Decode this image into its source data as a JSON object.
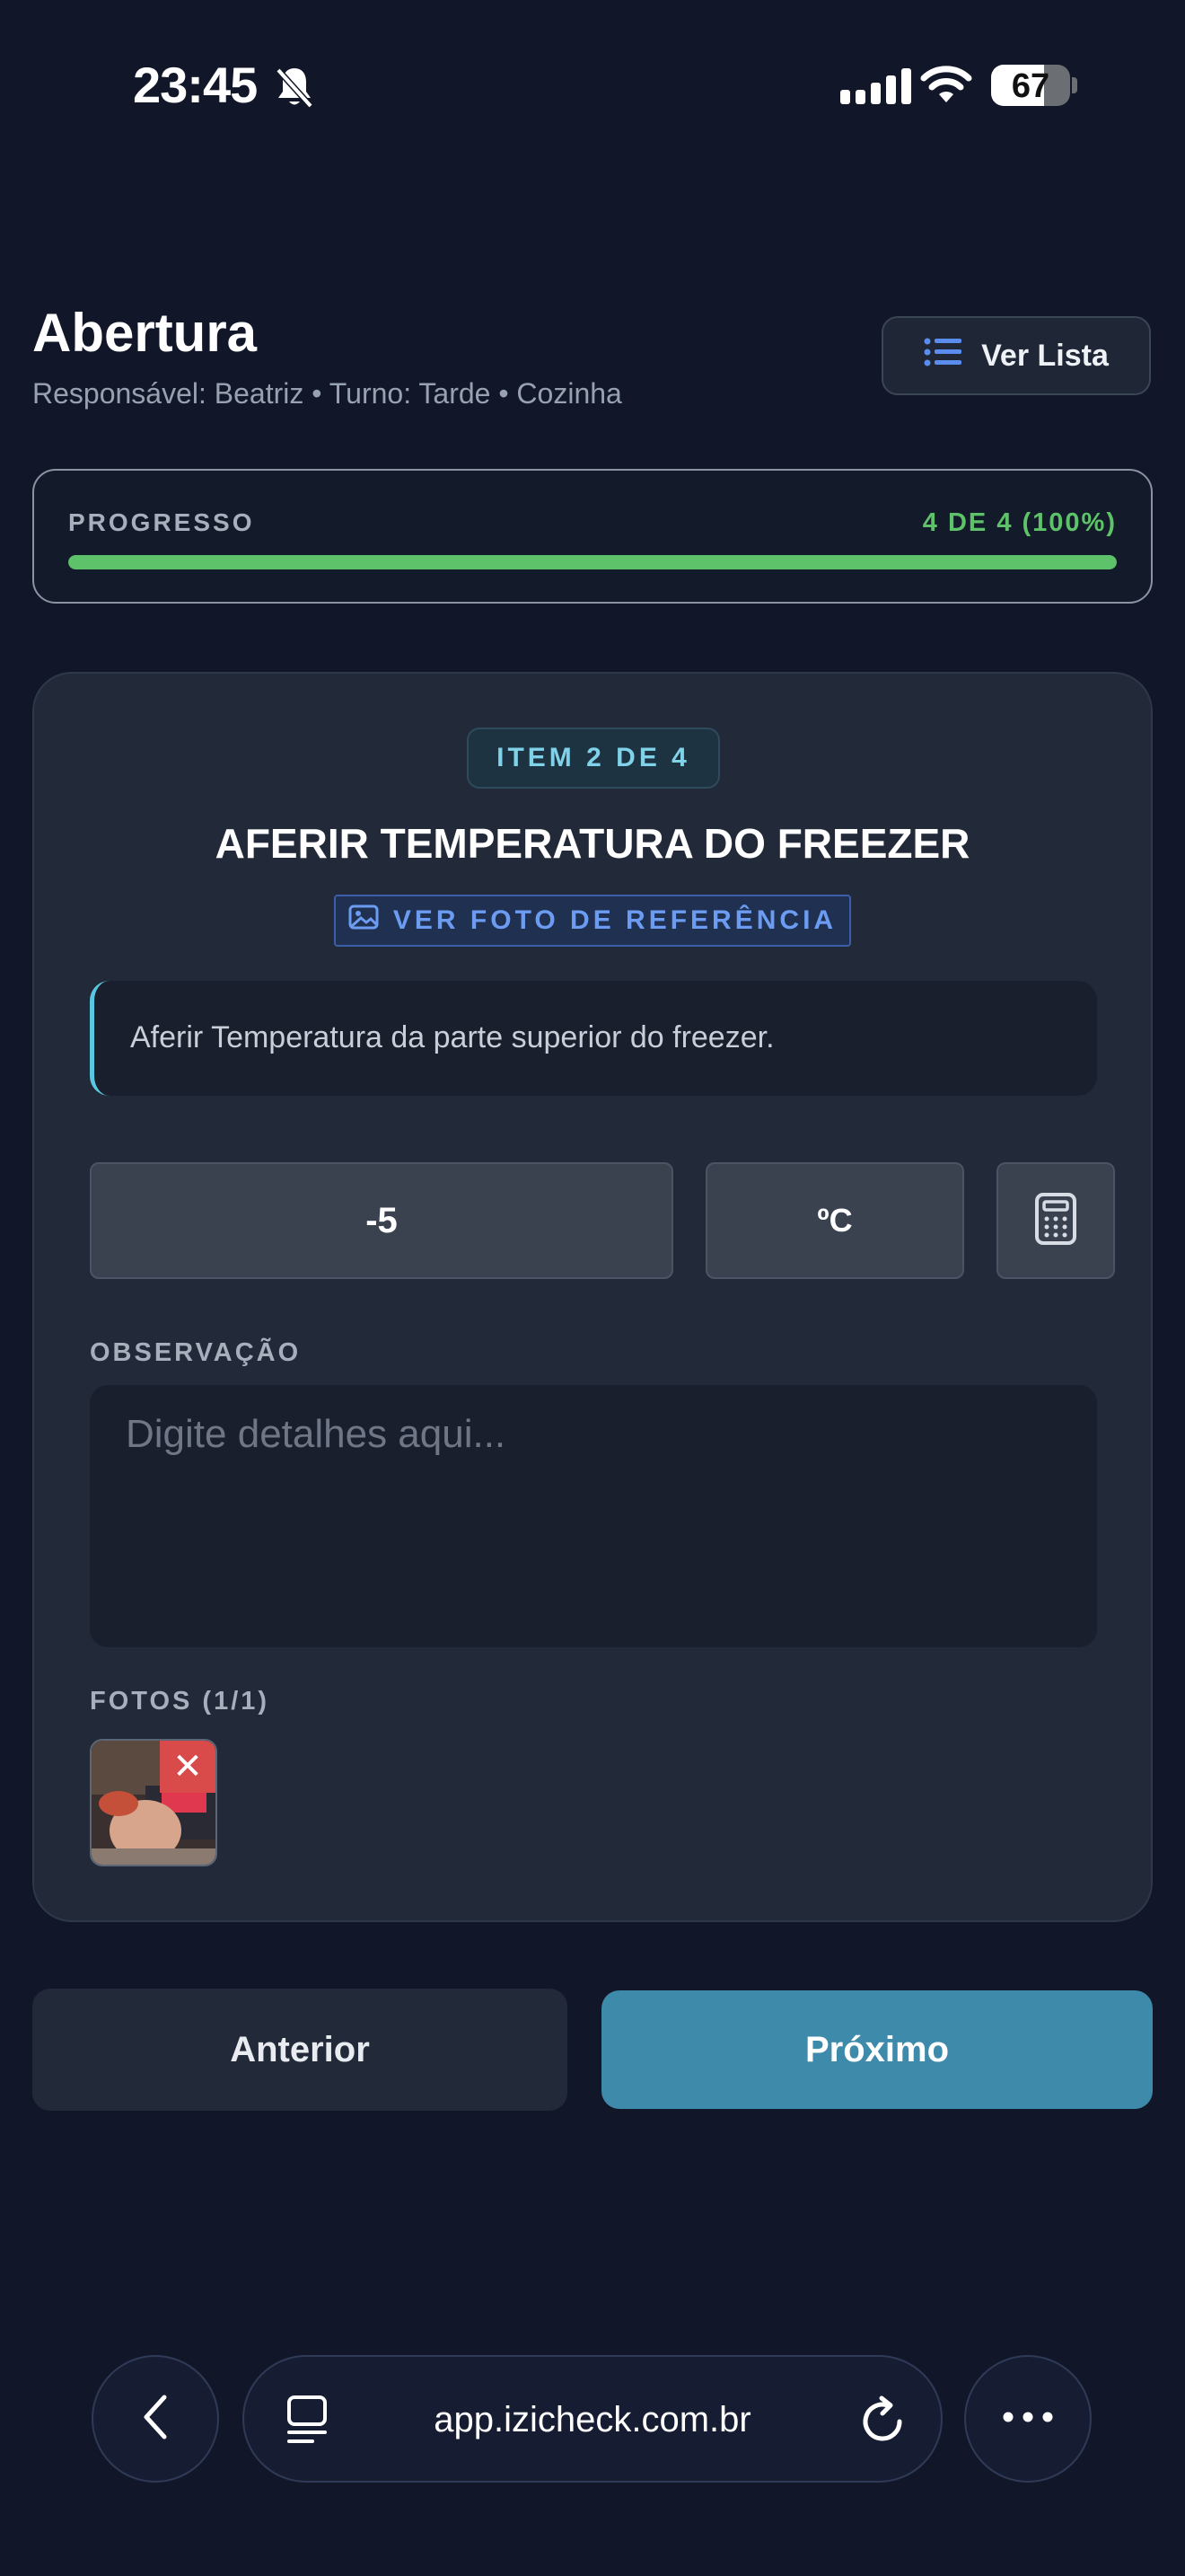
{
  "status_bar": {
    "time": "23:45",
    "battery": "67"
  },
  "header": {
    "title": "Abertura",
    "subtitle": "Responsável: Beatriz • Turno: Tarde • Cozinha",
    "view_list_label": "Ver Lista"
  },
  "progress": {
    "label": "PROGRESSO",
    "value_text": "4 DE 4 (100%)",
    "fraction": 1.0
  },
  "item": {
    "badge": "ITEM 2 DE 4",
    "title": "AFERIR TEMPERATURA DO FREEZER",
    "reference_photo_label": "VER FOTO DE REFERÊNCIA",
    "description": "Aferir Temperatura da parte superior do freezer.",
    "value": "-5",
    "unit": "ºC",
    "observation_label": "OBSERVAÇÃO",
    "observation_placeholder": "Digite detalhes aqui...",
    "photos_label": "FOTOS (1/1)",
    "photo_remove_symbol": "✕"
  },
  "navigation": {
    "previous_label": "Anterior",
    "next_label": "Próximo"
  },
  "browser": {
    "url": "app.izicheck.com.br"
  },
  "colors": {
    "accent": "#3e8aab",
    "success": "#5ec26a",
    "badge_text": "#7fd2e8",
    "link": "#6c9cf2",
    "danger": "#d94a4a"
  }
}
